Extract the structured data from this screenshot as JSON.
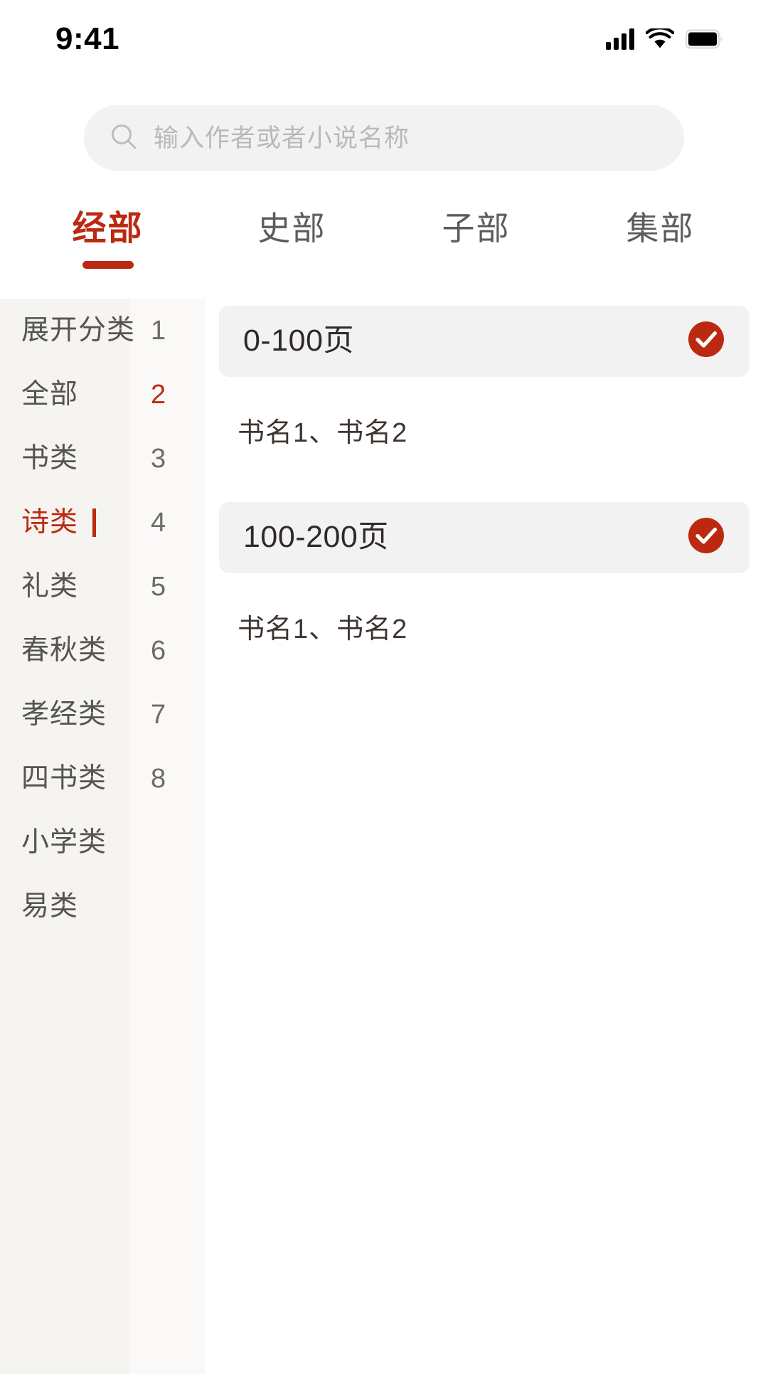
{
  "status_bar": {
    "time": "9:41",
    "signal_icon": "signal-bars-icon",
    "wifi_icon": "wifi-icon",
    "battery_icon": "battery-full-icon"
  },
  "search": {
    "icon": "search-icon",
    "placeholder": "输入作者或者小说名称",
    "value": ""
  },
  "tabs": [
    {
      "label": "经部",
      "active": true
    },
    {
      "label": "史部",
      "active": false
    },
    {
      "label": "子部",
      "active": false
    },
    {
      "label": "集部",
      "active": false
    }
  ],
  "sidebar": {
    "items": [
      {
        "label": "展开分类",
        "number": "1",
        "selected": false,
        "number_accent": false,
        "caret": false
      },
      {
        "label": "全部",
        "number": "2",
        "selected": false,
        "number_accent": true,
        "caret": false
      },
      {
        "label": "书类",
        "number": "3",
        "selected": false,
        "number_accent": false,
        "caret": false
      },
      {
        "label": "诗类",
        "number": "4",
        "selected": true,
        "number_accent": false,
        "caret": true
      },
      {
        "label": "礼类",
        "number": "5",
        "selected": false,
        "number_accent": false,
        "caret": false
      },
      {
        "label": "春秋类",
        "number": "6",
        "selected": false,
        "number_accent": false,
        "caret": false
      },
      {
        "label": "孝经类",
        "number": "7",
        "selected": false,
        "number_accent": false,
        "caret": false
      },
      {
        "label": "四书类",
        "number": "8",
        "selected": false,
        "number_accent": false,
        "caret": false
      },
      {
        "label": "小学类",
        "number": "",
        "selected": false,
        "number_accent": false,
        "caret": false
      },
      {
        "label": "易类",
        "number": "",
        "selected": false,
        "number_accent": false,
        "caret": false
      }
    ]
  },
  "panel": {
    "groups": [
      {
        "range_label": "0-100页",
        "checked": true,
        "check_icon": "check-circle-icon",
        "books": "书名1、书名2"
      },
      {
        "range_label": "100-200页",
        "checked": true,
        "check_icon": "check-circle-icon",
        "books": "书名1、书名2"
      }
    ]
  },
  "colors": {
    "accent": "#bb2a10",
    "text_primary": "#2f2a28",
    "text_secondary": "#565451",
    "placeholder": "#b9b9b9",
    "search_bg": "#f2f2f2",
    "sidebar_label_bg": "#f5f4f1",
    "sidebar_number_bg": "#faf9f7",
    "card_bg": "#f3f2f2"
  }
}
